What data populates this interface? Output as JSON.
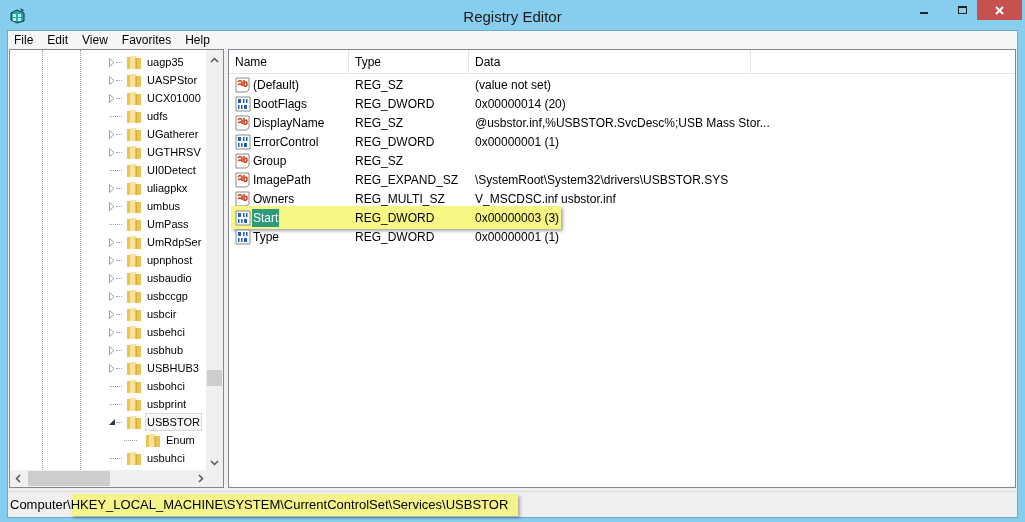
{
  "window": {
    "title": "Registry Editor"
  },
  "menu": [
    "File",
    "Edit",
    "View",
    "Favorites",
    "Help"
  ],
  "tree": [
    {
      "label": "uagp35",
      "expandable": true,
      "expanded": false,
      "selected": false
    },
    {
      "label": "UASPStor",
      "expandable": true,
      "expanded": false,
      "selected": false
    },
    {
      "label": "UCX01000",
      "expandable": true,
      "expanded": false,
      "selected": false
    },
    {
      "label": "udfs",
      "expandable": false,
      "selected": false
    },
    {
      "label": "UGatherer",
      "expandable": true,
      "expanded": false,
      "selected": false
    },
    {
      "label": "UGTHRSV",
      "expandable": true,
      "expanded": false,
      "selected": false
    },
    {
      "label": "UI0Detect",
      "expandable": false,
      "selected": false
    },
    {
      "label": "uliagpkx",
      "expandable": true,
      "expanded": false,
      "selected": false
    },
    {
      "label": "umbus",
      "expandable": true,
      "expanded": false,
      "selected": false
    },
    {
      "label": "UmPass",
      "expandable": false,
      "selected": false
    },
    {
      "label": "UmRdpSer",
      "expandable": true,
      "expanded": false,
      "selected": false
    },
    {
      "label": "upnphost",
      "expandable": true,
      "expanded": false,
      "selected": false
    },
    {
      "label": "usbaudio",
      "expandable": true,
      "expanded": false,
      "selected": false
    },
    {
      "label": "usbccgp",
      "expandable": true,
      "expanded": false,
      "selected": false
    },
    {
      "label": "usbcir",
      "expandable": true,
      "expanded": false,
      "selected": false
    },
    {
      "label": "usbehci",
      "expandable": true,
      "expanded": false,
      "selected": false
    },
    {
      "label": "usbhub",
      "expandable": true,
      "expanded": false,
      "selected": false
    },
    {
      "label": "USBHUB3",
      "expandable": true,
      "expanded": false,
      "selected": false
    },
    {
      "label": "usbohci",
      "expandable": false,
      "selected": false
    },
    {
      "label": "usbprint",
      "expandable": false,
      "selected": false
    },
    {
      "label": "USBSTOR",
      "expandable": true,
      "expanded": true,
      "selected": true,
      "children": [
        {
          "label": "Enum",
          "expandable": false,
          "selected": false
        }
      ]
    },
    {
      "label": "usbuhci",
      "expandable": false,
      "selected": false
    }
  ],
  "table": {
    "columns": [
      "Name",
      "Type",
      "Data"
    ],
    "rows": [
      {
        "kind": "string",
        "name": "(Default)",
        "type": "REG_SZ",
        "data": "(value not set)",
        "selected": false,
        "highlighted": false
      },
      {
        "kind": "binary",
        "name": "BootFlags",
        "type": "REG_DWORD",
        "data": "0x00000014 (20)",
        "selected": false,
        "highlighted": false
      },
      {
        "kind": "string",
        "name": "DisplayName",
        "type": "REG_SZ",
        "data": "@usbstor.inf,%USBSTOR.SvcDesc%;USB Mass Stor...",
        "selected": false,
        "highlighted": false
      },
      {
        "kind": "binary",
        "name": "ErrorControl",
        "type": "REG_DWORD",
        "data": "0x00000001 (1)",
        "selected": false,
        "highlighted": false
      },
      {
        "kind": "string",
        "name": "Group",
        "type": "REG_SZ",
        "selected": false,
        "highlighted": false
      },
      {
        "kind": "string",
        "name": "ImagePath",
        "type": "REG_EXPAND_SZ",
        "data": "\\SystemRoot\\System32\\drivers\\USBSTOR.SYS",
        "selected": false,
        "highlighted": false
      },
      {
        "kind": "string",
        "name": "Owners",
        "type": "REG_MULTI_SZ",
        "data": "V_MSCDSC.inf usbstor.inf",
        "selected": false,
        "highlighted": false
      },
      {
        "kind": "binary",
        "name": "Start",
        "type": "REG_DWORD",
        "data": "0x00000003 (3)",
        "selected": true,
        "highlighted": true
      },
      {
        "kind": "binary",
        "name": "Type",
        "type": "REG_DWORD",
        "data": "0x00000001 (1)",
        "selected": false,
        "highlighted": false
      }
    ]
  },
  "status_bar": {
    "prefix": "Computer\\",
    "path": "HKEY_LOCAL_MACHINE\\SYSTEM\\CurrentControlSet\\Services\\USBSTOR",
    "highlighted": true
  }
}
